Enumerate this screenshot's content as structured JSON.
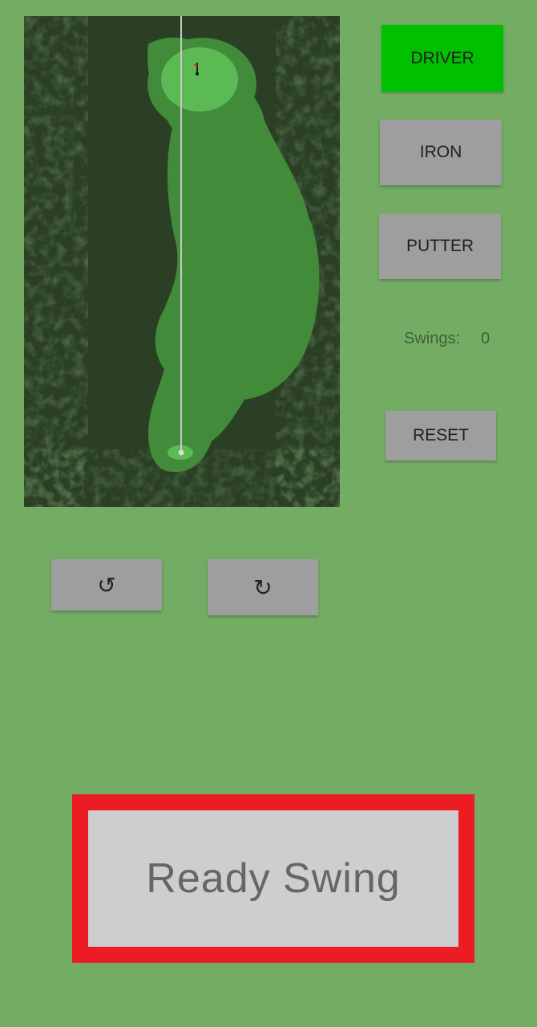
{
  "clubs": {
    "driver": "DRIVER",
    "iron": "IRON",
    "putter": "PUTTER",
    "selected": "DRIVER",
    "active_color": "#00c100",
    "inactive_color": "#9e9e9e"
  },
  "stats": {
    "swings_label": "Swings:",
    "swings_value": "0"
  },
  "controls": {
    "reset_label": "RESET",
    "rotate_left_icon": "↺",
    "rotate_right_icon": "↻",
    "swing_label": "Ready Swing"
  },
  "course": {
    "rough_color": "#2a3f23",
    "fairway_color": "#428b3a",
    "green_color": "#5cba55",
    "aim_line_color": "#c8c8c8",
    "flag_icon": "flag-icon",
    "ball_icon": "golf-ball-icon"
  },
  "theme": {
    "background": "#72ad63",
    "highlight_border": "#ec1c24"
  }
}
